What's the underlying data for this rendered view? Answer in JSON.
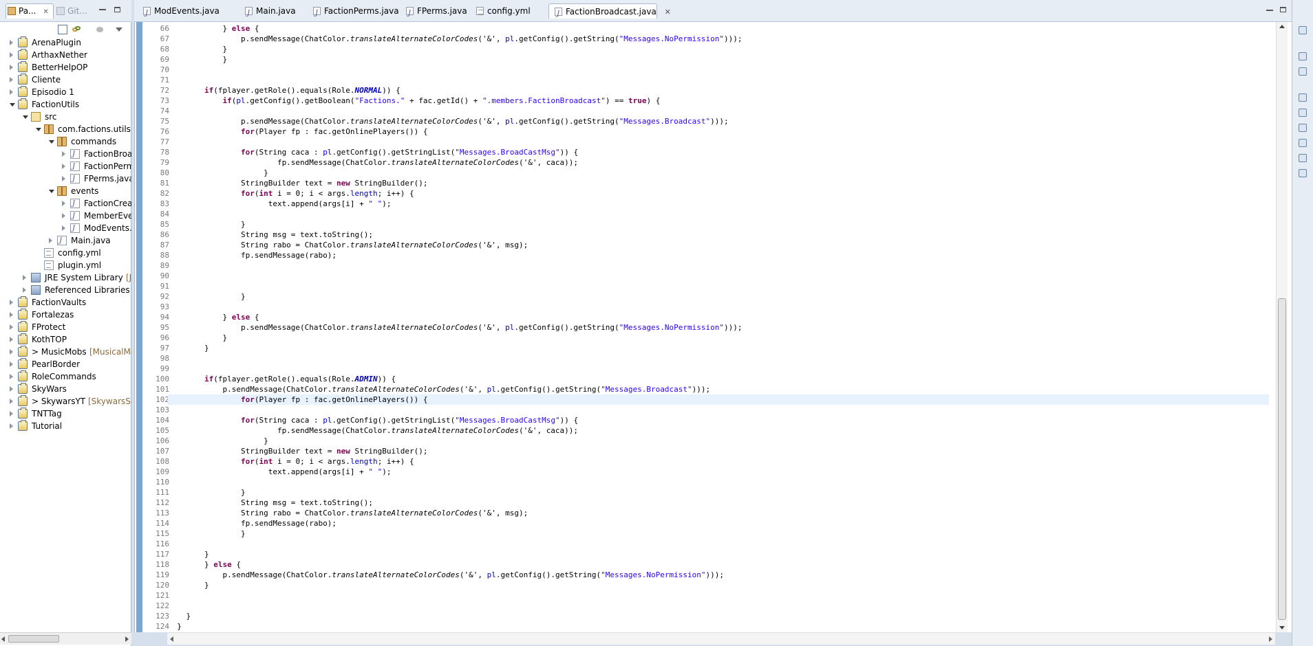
{
  "explorer": {
    "tabs": [
      {
        "label": "Pa..."
      },
      {
        "label": "Git..."
      }
    ],
    "tree": [
      {
        "label": "ArenaPlugin",
        "type": "project",
        "depth": 0,
        "expanded": false
      },
      {
        "label": "ArthaxNether",
        "type": "project",
        "depth": 0,
        "expanded": false
      },
      {
        "label": "BetterHelpOP",
        "type": "project",
        "depth": 0,
        "expanded": false
      },
      {
        "label": "Cliente",
        "type": "project",
        "depth": 0,
        "expanded": false
      },
      {
        "label": "Episodio 1",
        "type": "project",
        "depth": 0,
        "expanded": false
      },
      {
        "label": "FactionUtils",
        "type": "project",
        "depth": 0,
        "expanded": true
      },
      {
        "label": "src",
        "type": "src",
        "depth": 1,
        "expanded": true
      },
      {
        "label": "com.factions.utils",
        "type": "package",
        "depth": 2,
        "expanded": true
      },
      {
        "label": "commands",
        "type": "package",
        "depth": 3,
        "expanded": true
      },
      {
        "label": "FactionBroa",
        "type": "java",
        "depth": 4,
        "expanded": false
      },
      {
        "label": "FactionPerm",
        "type": "java",
        "depth": 4,
        "expanded": false
      },
      {
        "label": "FPerms.java",
        "type": "java",
        "depth": 4,
        "expanded": false
      },
      {
        "label": "events",
        "type": "package",
        "depth": 3,
        "expanded": true
      },
      {
        "label": "FactionCrea",
        "type": "java",
        "depth": 4,
        "expanded": false
      },
      {
        "label": "MemberEve",
        "type": "java",
        "depth": 4,
        "expanded": false
      },
      {
        "label": "ModEvents.",
        "type": "java",
        "depth": 4,
        "expanded": false
      },
      {
        "label": "Main.java",
        "type": "java",
        "depth": 3,
        "expanded": false
      },
      {
        "label": "config.yml",
        "type": "yml",
        "depth": 2,
        "expanded": null
      },
      {
        "label": "plugin.yml",
        "type": "yml",
        "depth": 2,
        "expanded": null
      },
      {
        "label": "JRE System Library",
        "decoration": "[Jav",
        "type": "library",
        "depth": 1,
        "expanded": false
      },
      {
        "label": "Referenced Libraries",
        "type": "library",
        "depth": 1,
        "expanded": false
      },
      {
        "label": "FactionVaults",
        "type": "project",
        "depth": 0,
        "expanded": false
      },
      {
        "label": "Fortalezas",
        "type": "project",
        "depth": 0,
        "expanded": false
      },
      {
        "label": "FProtect",
        "type": "project",
        "depth": 0,
        "expanded": false
      },
      {
        "label": "KothTOP",
        "type": "project",
        "depth": 0,
        "expanded": false
      },
      {
        "label": "> MusicMobs",
        "decoration": "[MusicalMo",
        "type": "project",
        "depth": 0,
        "expanded": false
      },
      {
        "label": "PearlBorder",
        "type": "project",
        "depth": 0,
        "expanded": false
      },
      {
        "label": "RoleCommands",
        "type": "project",
        "depth": 0,
        "expanded": false
      },
      {
        "label": "SkyWars",
        "type": "project",
        "depth": 0,
        "expanded": false
      },
      {
        "label": "> SkywarsYT",
        "decoration": "[SkywarsSerie",
        "type": "project",
        "depth": 0,
        "expanded": false
      },
      {
        "label": "TNTTag",
        "type": "project",
        "depth": 0,
        "expanded": false
      },
      {
        "label": "Tutorial",
        "type": "project",
        "depth": 0,
        "expanded": false
      }
    ]
  },
  "editor": {
    "tabs": [
      {
        "label": "ModEvents.java",
        "active": false
      },
      {
        "label": "Main.java",
        "active": false
      },
      {
        "label": "FactionPerms.java",
        "active": false
      },
      {
        "label": "FPerms.java",
        "active": false
      },
      {
        "label": "config.yml",
        "active": false
      },
      {
        "label": "FactionBroadcast.java",
        "active": true
      }
    ],
    "current_line": 102,
    "lines": [
      {
        "n": "66",
        "segs": [
          [
            "            } ",
            ""
          ],
          [
            "else",
            "kw"
          ],
          [
            " {",
            ""
          ]
        ]
      },
      {
        "n": "67",
        "segs": [
          [
            "                p.sendMessage(ChatColor.",
            ""
          ],
          [
            "translateAlternateColorCodes",
            "ital"
          ],
          [
            "('&', ",
            ""
          ],
          [
            "pl",
            "fld"
          ],
          [
            ".getConfig().getString(",
            ""
          ],
          [
            "\"Messages.NoPermission\"",
            "str"
          ],
          [
            ")));",
            ""
          ]
        ]
      },
      {
        "n": "68",
        "segs": [
          [
            "            }",
            ""
          ]
        ]
      },
      {
        "n": "69",
        "segs": [
          [
            "            }",
            ""
          ]
        ]
      },
      {
        "n": "70",
        "segs": [
          [
            "",
            ""
          ]
        ]
      },
      {
        "n": "71",
        "segs": [
          [
            "",
            ""
          ]
        ]
      },
      {
        "n": "72",
        "segs": [
          [
            "        ",
            ""
          ],
          [
            "if",
            "kw"
          ],
          [
            "(fplayer.getRole().equals(Role.",
            ""
          ],
          [
            "NORMAL",
            "sfld"
          ],
          [
            ")) {",
            ""
          ]
        ]
      },
      {
        "n": "73",
        "segs": [
          [
            "            ",
            ""
          ],
          [
            "if",
            "kw"
          ],
          [
            "(",
            ""
          ],
          [
            "pl",
            "fld"
          ],
          [
            ".getConfig().getBoolean(",
            ""
          ],
          [
            "\"Factions.\"",
            "str"
          ],
          [
            " + fac.getId() + ",
            ""
          ],
          [
            "\".members.FactionBroadcast\"",
            "str"
          ],
          [
            ") == ",
            ""
          ],
          [
            "true",
            "kw"
          ],
          [
            ") {",
            ""
          ]
        ]
      },
      {
        "n": "74",
        "segs": [
          [
            "",
            ""
          ]
        ]
      },
      {
        "n": "75",
        "segs": [
          [
            "                p.sendMessage(ChatColor.",
            ""
          ],
          [
            "translateAlternateColorCodes",
            "ital"
          ],
          [
            "('&', ",
            ""
          ],
          [
            "pl",
            "fld"
          ],
          [
            ".getConfig().getString(",
            ""
          ],
          [
            "\"Messages.Broadcast\"",
            "str"
          ],
          [
            ")));",
            ""
          ]
        ]
      },
      {
        "n": "76",
        "segs": [
          [
            "                ",
            ""
          ],
          [
            "for",
            "kw"
          ],
          [
            "(Player fp : fac.getOnlinePlayers()) {",
            ""
          ]
        ]
      },
      {
        "n": "77",
        "segs": [
          [
            "",
            ""
          ]
        ]
      },
      {
        "n": "78",
        "segs": [
          [
            "                ",
            ""
          ],
          [
            "for",
            "kw"
          ],
          [
            "(String caca : ",
            ""
          ],
          [
            "pl",
            "fld"
          ],
          [
            ".getConfig().getStringList(",
            ""
          ],
          [
            "\"Messages.BroadCastMsg\"",
            "str"
          ],
          [
            ")) {",
            ""
          ]
        ]
      },
      {
        "n": "79",
        "segs": [
          [
            "                        fp.sendMessage(ChatColor.",
            ""
          ],
          [
            "translateAlternateColorCodes",
            "ital"
          ],
          [
            "('&', caca));",
            ""
          ]
        ]
      },
      {
        "n": "80",
        "segs": [
          [
            "                     }",
            ""
          ]
        ]
      },
      {
        "n": "81",
        "segs": [
          [
            "                StringBuilder text = ",
            ""
          ],
          [
            "new",
            "kw"
          ],
          [
            " StringBuilder();",
            ""
          ]
        ]
      },
      {
        "n": "82",
        "segs": [
          [
            "                ",
            ""
          ],
          [
            "for",
            "kw"
          ],
          [
            "(",
            ""
          ],
          [
            "int",
            "kw"
          ],
          [
            " i = 0; i < args.",
            ""
          ],
          [
            "length",
            "fld"
          ],
          [
            "; i++) {",
            ""
          ]
        ]
      },
      {
        "n": "83",
        "segs": [
          [
            "                      text.append(args[i] + ",
            ""
          ],
          [
            "\" \"",
            "str"
          ],
          [
            ");",
            ""
          ]
        ]
      },
      {
        "n": "84",
        "segs": [
          [
            "",
            ""
          ]
        ]
      },
      {
        "n": "85",
        "segs": [
          [
            "                }",
            ""
          ]
        ]
      },
      {
        "n": "86",
        "segs": [
          [
            "                String msg = text.toString();",
            ""
          ]
        ]
      },
      {
        "n": "87",
        "segs": [
          [
            "                String rabo = ChatColor.",
            ""
          ],
          [
            "translateAlternateColorCodes",
            "ital"
          ],
          [
            "('&', msg);",
            ""
          ]
        ]
      },
      {
        "n": "88",
        "segs": [
          [
            "                fp.sendMessage(rabo);",
            ""
          ]
        ]
      },
      {
        "n": "89",
        "segs": [
          [
            "",
            ""
          ]
        ]
      },
      {
        "n": "90",
        "segs": [
          [
            "",
            ""
          ]
        ]
      },
      {
        "n": "91",
        "segs": [
          [
            "",
            ""
          ]
        ]
      },
      {
        "n": "92",
        "segs": [
          [
            "                }",
            ""
          ]
        ]
      },
      {
        "n": "93",
        "segs": [
          [
            "",
            ""
          ]
        ]
      },
      {
        "n": "94",
        "segs": [
          [
            "            } ",
            ""
          ],
          [
            "else",
            "kw"
          ],
          [
            " {",
            ""
          ]
        ]
      },
      {
        "n": "95",
        "segs": [
          [
            "                p.sendMessage(ChatColor.",
            ""
          ],
          [
            "translateAlternateColorCodes",
            "ital"
          ],
          [
            "('&', ",
            ""
          ],
          [
            "pl",
            "fld"
          ],
          [
            ".getConfig().getString(",
            ""
          ],
          [
            "\"Messages.NoPermission\"",
            "str"
          ],
          [
            ")));",
            ""
          ]
        ]
      },
      {
        "n": "96",
        "segs": [
          [
            "            }",
            ""
          ]
        ]
      },
      {
        "n": "97",
        "segs": [
          [
            "        }",
            ""
          ]
        ]
      },
      {
        "n": "98",
        "segs": [
          [
            "",
            ""
          ]
        ]
      },
      {
        "n": "99",
        "segs": [
          [
            "",
            ""
          ]
        ]
      },
      {
        "n": "100",
        "segs": [
          [
            "        ",
            ""
          ],
          [
            "if",
            "kw"
          ],
          [
            "(fplayer.getRole().equals(Role.",
            ""
          ],
          [
            "ADMIN",
            "sfld"
          ],
          [
            ")) {",
            ""
          ]
        ]
      },
      {
        "n": "101",
        "segs": [
          [
            "            p.sendMessage(ChatColor.",
            ""
          ],
          [
            "translateAlternateColorCodes",
            "ital"
          ],
          [
            "('&', ",
            ""
          ],
          [
            "pl",
            "fld"
          ],
          [
            ".getConfig().getString(",
            ""
          ],
          [
            "\"Messages.Broadcast\"",
            "str"
          ],
          [
            ")));",
            ""
          ]
        ]
      },
      {
        "n": "102",
        "segs": [
          [
            "                ",
            ""
          ],
          [
            "for",
            "kw"
          ],
          [
            "(Player fp : fac.getOnlinePlayers()) {",
            ""
          ]
        ]
      },
      {
        "n": "103",
        "segs": [
          [
            "",
            ""
          ]
        ]
      },
      {
        "n": "104",
        "segs": [
          [
            "                ",
            ""
          ],
          [
            "for",
            "kw"
          ],
          [
            "(String caca : ",
            ""
          ],
          [
            "pl",
            "fld"
          ],
          [
            ".getConfig().getStringList(",
            ""
          ],
          [
            "\"Messages.BroadCastMsg\"",
            "str"
          ],
          [
            ")) {",
            ""
          ]
        ]
      },
      {
        "n": "105",
        "segs": [
          [
            "                        fp.sendMessage(ChatColor.",
            ""
          ],
          [
            "translateAlternateColorCodes",
            "ital"
          ],
          [
            "('&', caca));",
            ""
          ]
        ]
      },
      {
        "n": "106",
        "segs": [
          [
            "                     }",
            ""
          ]
        ]
      },
      {
        "n": "107",
        "segs": [
          [
            "                StringBuilder text = ",
            ""
          ],
          [
            "new",
            "kw"
          ],
          [
            " StringBuilder();",
            ""
          ]
        ]
      },
      {
        "n": "108",
        "segs": [
          [
            "                ",
            ""
          ],
          [
            "for",
            "kw"
          ],
          [
            "(",
            ""
          ],
          [
            "int",
            "kw"
          ],
          [
            " i = 0; i < args.",
            ""
          ],
          [
            "length",
            "fld"
          ],
          [
            "; i++) {",
            ""
          ]
        ]
      },
      {
        "n": "109",
        "segs": [
          [
            "                      text.append(args[i] + ",
            ""
          ],
          [
            "\" \"",
            "str"
          ],
          [
            ");",
            ""
          ]
        ]
      },
      {
        "n": "110",
        "segs": [
          [
            "",
            ""
          ]
        ]
      },
      {
        "n": "111",
        "segs": [
          [
            "                }",
            ""
          ]
        ]
      },
      {
        "n": "112",
        "segs": [
          [
            "                String msg = text.toString();",
            ""
          ]
        ]
      },
      {
        "n": "113",
        "segs": [
          [
            "                String rabo = ChatColor.",
            ""
          ],
          [
            "translateAlternateColorCodes",
            "ital"
          ],
          [
            "('&', msg);",
            ""
          ]
        ]
      },
      {
        "n": "114",
        "segs": [
          [
            "                fp.sendMessage(rabo);",
            ""
          ]
        ]
      },
      {
        "n": "115",
        "segs": [
          [
            "                }",
            ""
          ]
        ]
      },
      {
        "n": "116",
        "segs": [
          [
            "",
            ""
          ]
        ]
      },
      {
        "n": "117",
        "segs": [
          [
            "        }",
            ""
          ]
        ]
      },
      {
        "n": "118",
        "segs": [
          [
            "        } ",
            ""
          ],
          [
            "else",
            "kw"
          ],
          [
            " {",
            ""
          ]
        ]
      },
      {
        "n": "119",
        "segs": [
          [
            "            p.sendMessage(ChatColor.",
            ""
          ],
          [
            "translateAlternateColorCodes",
            "ital"
          ],
          [
            "('&', ",
            ""
          ],
          [
            "pl",
            "fld"
          ],
          [
            ".getConfig().getString(",
            ""
          ],
          [
            "\"Messages.NoPermission\"",
            "str"
          ],
          [
            ")));",
            ""
          ]
        ]
      },
      {
        "n": "120",
        "segs": [
          [
            "        }",
            ""
          ]
        ]
      },
      {
        "n": "121",
        "segs": [
          [
            "",
            ""
          ]
        ]
      },
      {
        "n": "122",
        "segs": [
          [
            "",
            ""
          ]
        ]
      },
      {
        "n": "123",
        "segs": [
          [
            "    }",
            ""
          ]
        ]
      },
      {
        "n": "124",
        "segs": [
          [
            "  }",
            ""
          ]
        ]
      }
    ]
  },
  "icons": {
    "package_explorer_tab": "package-explorer-icon",
    "git_tab": "git-icon",
    "collapse_all": "collapse-all-icon",
    "link_editor": "link-with-editor-icon",
    "view_menu": "view-menu-icon",
    "minimize": "minimize-icon",
    "maximize": "maximize-icon"
  },
  "colors": {
    "keyword": "#7f0055",
    "string": "#2a00ff",
    "field": "#0000c0",
    "current_line": "#e8f2fe",
    "ruler": "#7fa6d3"
  }
}
